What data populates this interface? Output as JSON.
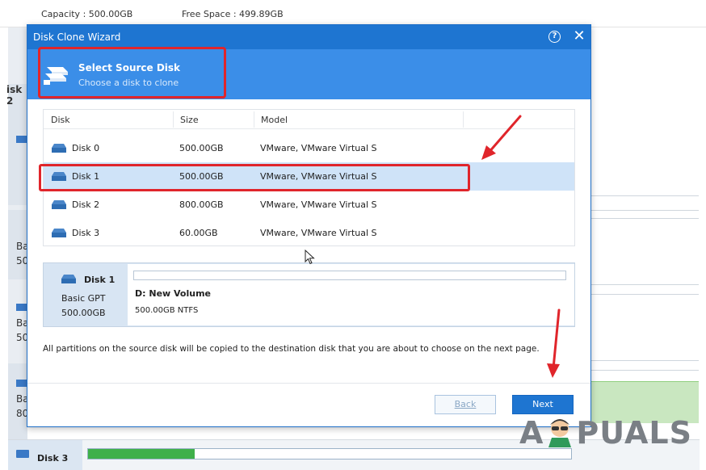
{
  "background": {
    "capacity_label": "Capacity : 500.00GB",
    "free_space_label": "Free Space : 499.89GB",
    "left_labels": [
      "isk 2",
      "Ba",
      "50",
      "Ba",
      "50",
      "Ba",
      "80"
    ],
    "bottom_disk_label": "Disk 3",
    "bottom_bar_fill_percent": 22
  },
  "dialog": {
    "title": "Disk Clone Wizard",
    "help_glyph": "?",
    "close_glyph": "✕",
    "step": {
      "title": "Select Source Disk",
      "subtitle": "Choose a disk to clone"
    },
    "table": {
      "headers": [
        "Disk",
        "Size",
        "Model"
      ],
      "rows": [
        {
          "disk": "Disk 0",
          "size": "500.00GB",
          "model": "VMware, VMware Virtual S"
        },
        {
          "disk": "Disk 1",
          "size": "500.00GB",
          "model": "VMware, VMware Virtual S",
          "selected": true
        },
        {
          "disk": "Disk 2",
          "size": "800.00GB",
          "model": "VMware, VMware Virtual S"
        },
        {
          "disk": "Disk 3",
          "size": "60.00GB",
          "model": "VMware, VMware Virtual S"
        }
      ]
    },
    "disk_map": {
      "name": "Disk 1",
      "type": "Basic GPT",
      "size": "500.00GB",
      "partition_name": "D: New Volume",
      "partition_info": "500.00GB NTFS"
    },
    "info_text": "All partitions on the source disk will be copied to the destination disk that you are about to choose on the next page.",
    "back_label": "Back",
    "next_label": "Next"
  },
  "watermark": {
    "left": "A",
    "right": "PUALS"
  },
  "colors": {
    "titlebar": "#1e75d1",
    "stepbar": "#3b8ee8",
    "selected_row": "#cfe3f8",
    "highlight_red": "#e0252b"
  },
  "icons": [
    "disk-icon",
    "help-icon",
    "close-icon",
    "cursor-icon",
    "arrow-icon"
  ]
}
